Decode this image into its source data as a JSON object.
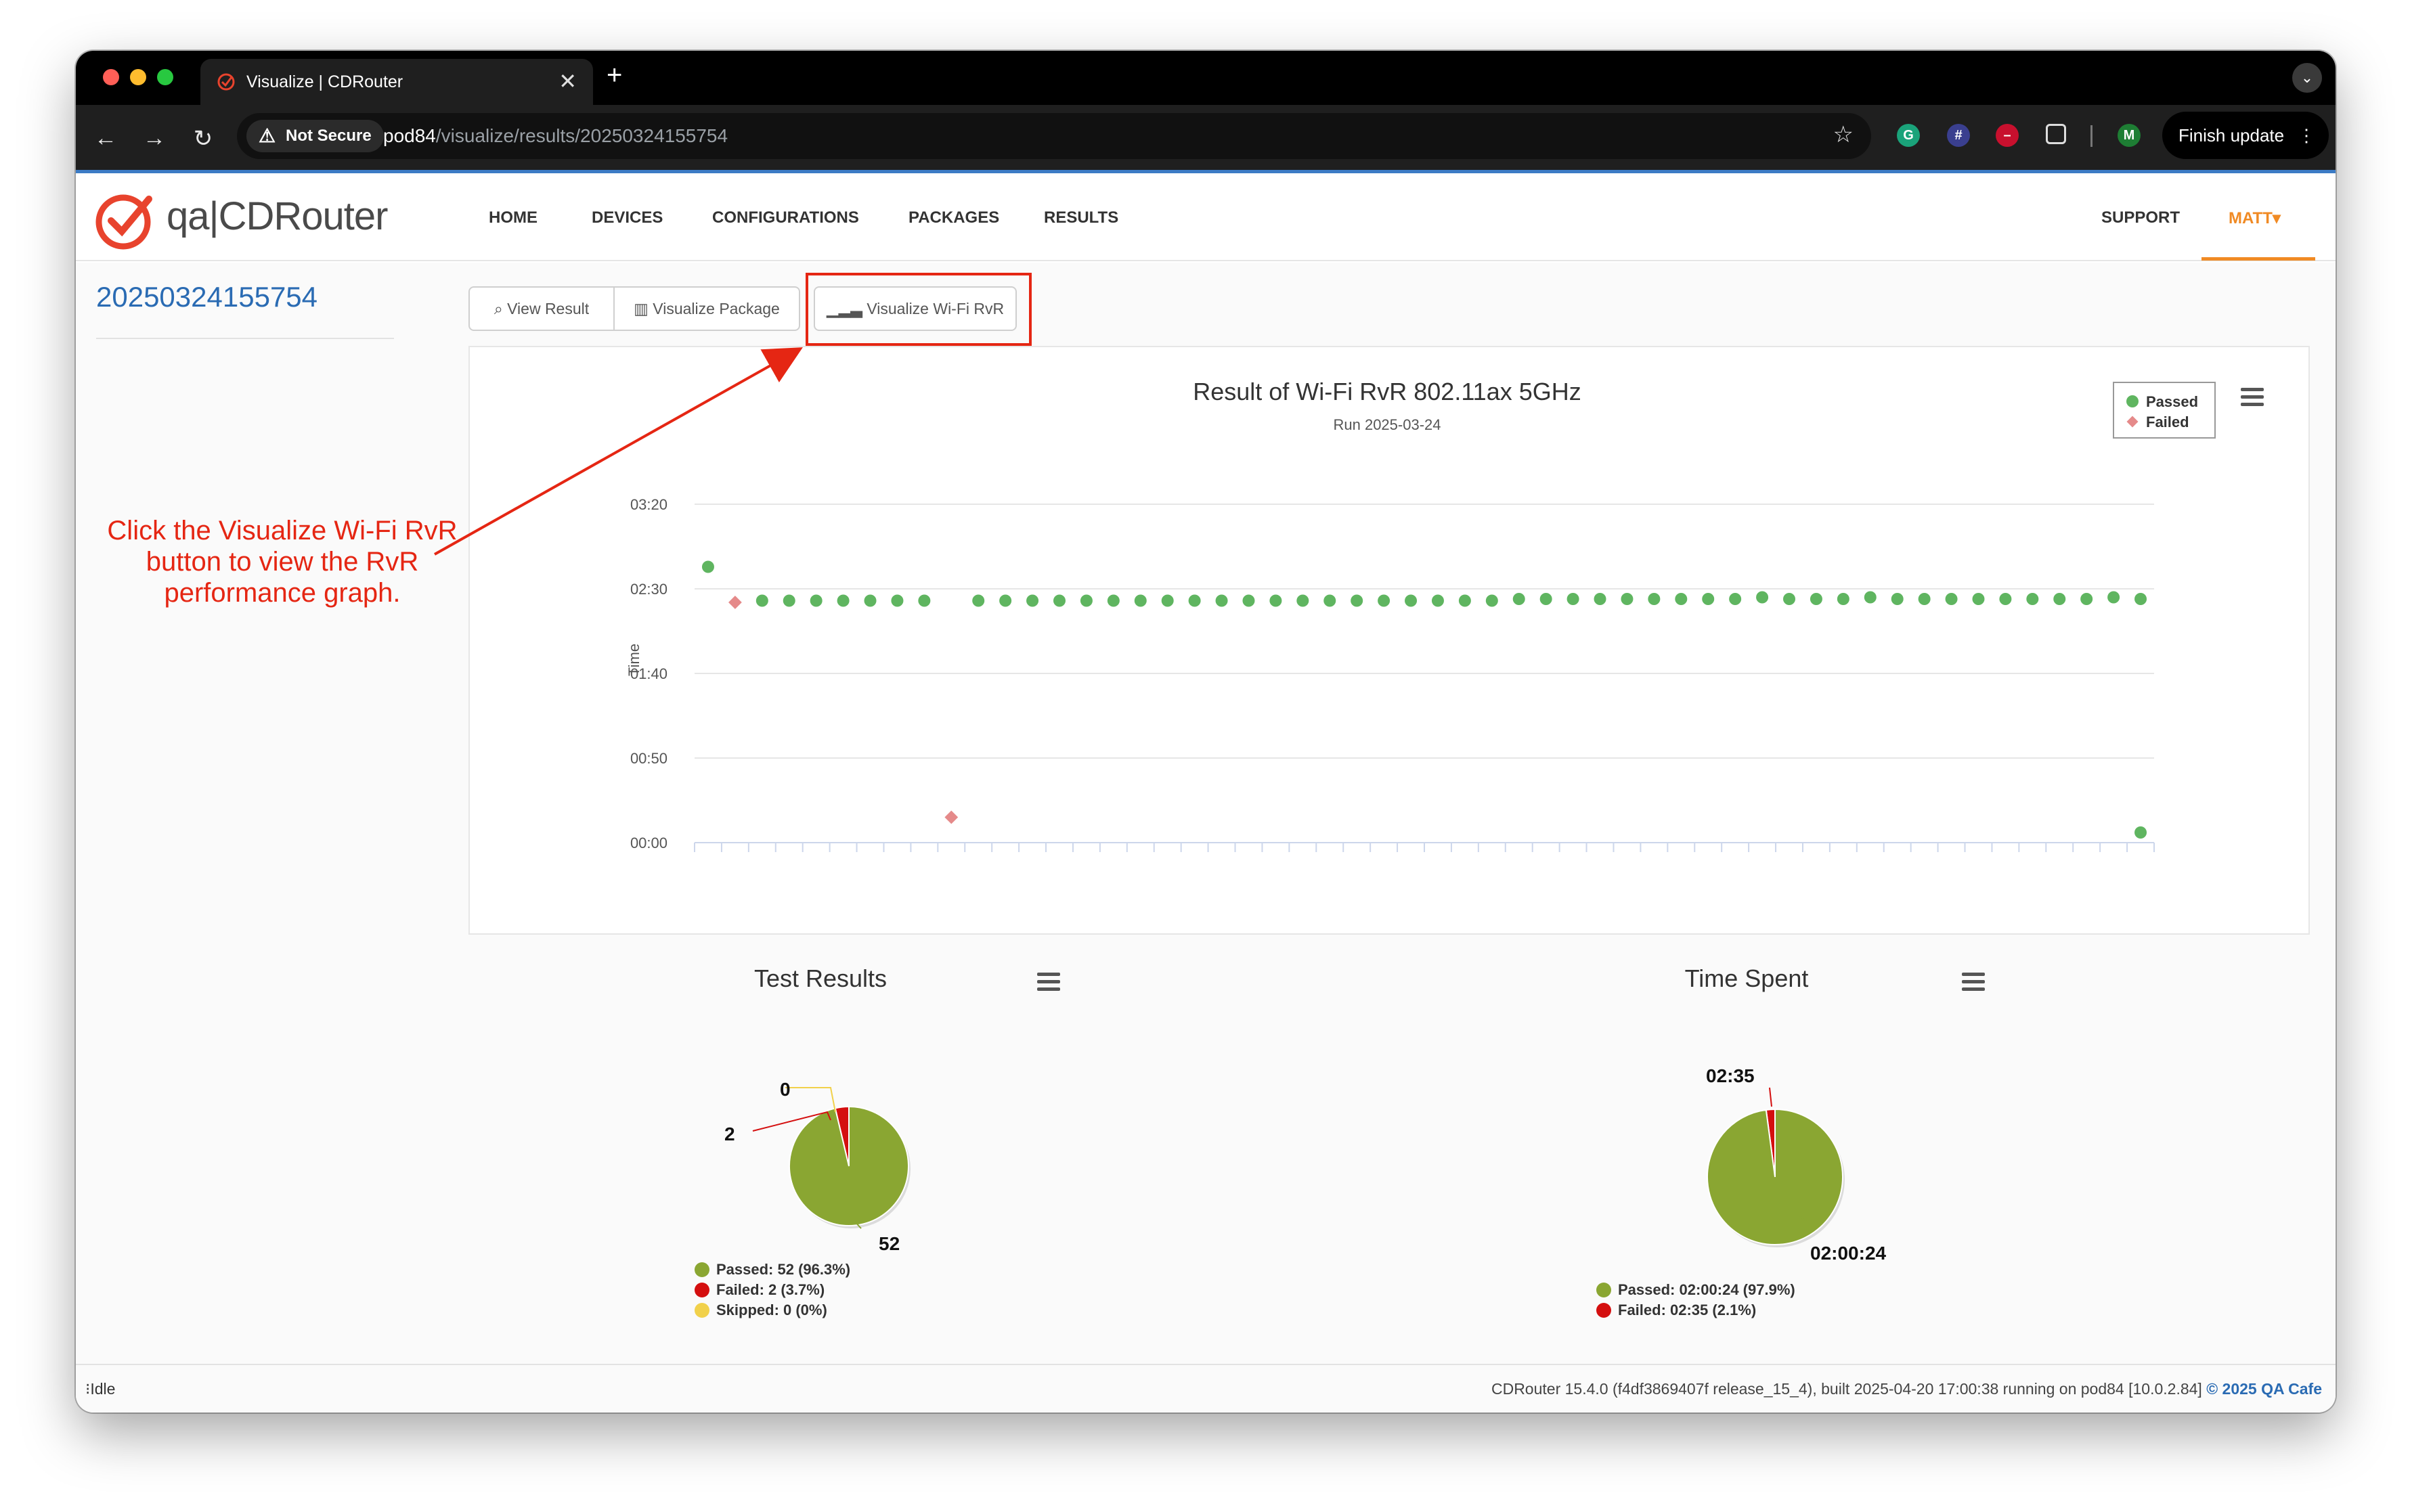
{
  "browser": {
    "tab_title": "Visualize | CDRouter",
    "tab_close": "✕",
    "new_tab": "+",
    "security_label": "Not Secure",
    "url_host": "pod84",
    "url_path": "/visualize/results/20250324155754",
    "profile_initial": "M",
    "finish_update_label": "Finish update"
  },
  "app": {
    "logo_text": "qa|CDRouter",
    "nav": [
      "HOME",
      "DEVICES",
      "CONFIGURATIONS",
      "PACKAGES",
      "RESULTS"
    ],
    "support_label": "SUPPORT",
    "user_label": "MATT"
  },
  "page": {
    "run_id": "20250324155754",
    "buttons": {
      "view_result": "View Result",
      "visualize_package": "Visualize Package",
      "visualize_wifi_rvr": "Visualize Wi-Fi RvR"
    },
    "annotation": "Click the Visualize Wi-Fi RvR button to view the RvR performance graph."
  },
  "chart_data": [
    {
      "type": "scatter",
      "title": "Result of Wi-Fi RvR 802.11ax 5GHz",
      "subtitle": "Run 2025-03-24",
      "ylabel": "Time",
      "ytick_labels": [
        "00:00",
        "00:50",
        "01:40",
        "02:30",
        "03:20"
      ],
      "ylim_seconds": [
        0,
        200
      ],
      "legend": {
        "placement": "top-right",
        "entries": [
          "Passed",
          "Failed"
        ]
      },
      "colors": {
        "passed": "#5fb560",
        "failed": "#e58a8a"
      },
      "series": [
        {
          "name": "Passed",
          "x": [
            1,
            3,
            4,
            5,
            6,
            7,
            8,
            9,
            11,
            12,
            13,
            14,
            15,
            16,
            17,
            18,
            19,
            20,
            21,
            22,
            23,
            24,
            25,
            26,
            27,
            28,
            29,
            30,
            31,
            32,
            33,
            34,
            35,
            36,
            37,
            38,
            39,
            40,
            41,
            42,
            43,
            44,
            45,
            46,
            47,
            48,
            49,
            50,
            51,
            52,
            53,
            54
          ],
          "values": [
            163,
            143,
            143,
            143,
            143,
            143,
            143,
            143,
            143,
            143,
            143,
            143,
            143,
            143,
            143,
            143,
            143,
            143,
            143,
            143,
            143,
            143,
            143,
            143,
            143,
            143,
            143,
            143,
            144,
            144,
            144,
            144,
            144,
            144,
            144,
            144,
            144,
            145,
            144,
            144,
            144,
            145,
            144,
            144,
            144,
            144,
            144,
            144,
            144,
            144,
            145,
            144
          ],
          "last_point": {
            "x": 54,
            "value": 6
          }
        },
        {
          "name": "Failed",
          "x": [
            2,
            10
          ],
          "values": [
            142,
            15
          ]
        }
      ]
    },
    {
      "type": "pie",
      "title": "Test Results",
      "slices": [
        {
          "label": "Passed",
          "value": 52,
          "percent": "96.3%",
          "color": "#8aa632"
        },
        {
          "label": "Failed",
          "value": 2,
          "percent": "3.7%",
          "color": "#d40f0f"
        },
        {
          "label": "Skipped",
          "value": 0,
          "percent": "0%",
          "color": "#f1d14b"
        }
      ],
      "data_labels": [
        "0",
        "2",
        "52"
      ],
      "legend": [
        "Passed: 52 (96.3%)",
        "Failed: 2 (3.7%)",
        "Skipped: 0 (0%)"
      ]
    },
    {
      "type": "pie",
      "title": "Time Spent",
      "slices": [
        {
          "label": "Passed",
          "value_seconds": 7224,
          "display": "02:00:24",
          "percent": "97.9%",
          "color": "#8aa632"
        },
        {
          "label": "Failed",
          "value_seconds": 155,
          "display": "02:35",
          "percent": "2.1%",
          "color": "#d40f0f"
        }
      ],
      "data_labels": [
        "02:35",
        "02:00:24"
      ],
      "legend": [
        "Passed: 02:00:24 (97.9%)",
        "Failed: 02:35 (2.1%)"
      ]
    }
  ],
  "footer": {
    "status": "Idle",
    "build_info": "CDRouter 15.4.0 (f4df3869407f release_15_4), built 2025-04-20 17:00:38 running on pod84 [10.0.2.84]",
    "copyright": "© 2025 QA Cafe"
  }
}
